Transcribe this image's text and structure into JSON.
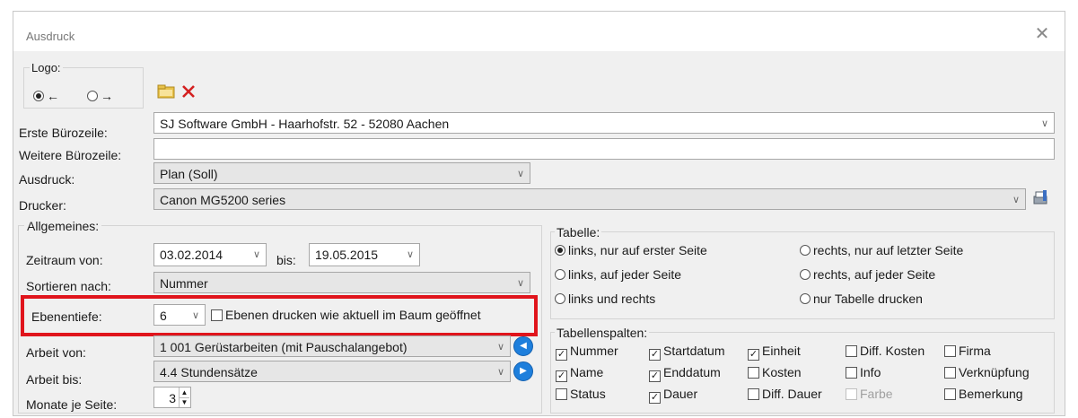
{
  "window": {
    "title": "Ausdruck"
  },
  "logo": {
    "label": "Logo:",
    "option_left": "←",
    "option_right": "→"
  },
  "fields": {
    "erste_label": "Erste Bürozeile:",
    "erste_value": "SJ Software GmbH - Haarhofstr. 52 - 52080 Aachen",
    "weitere_label": "Weitere Bürozeile:",
    "weitere_value": "",
    "ausdruck_label": "Ausdruck:",
    "ausdruck_value": "Plan (Soll)",
    "drucker_label": "Drucker:",
    "drucker_value": "Canon MG5200 series"
  },
  "allgemeines": {
    "title": "Allgemeines:",
    "zeitraum_label": "Zeitraum von:",
    "zeitraum_von": "03.02.2014",
    "bis_label": "bis:",
    "zeitraum_bis": "19.05.2015",
    "sortieren_label": "Sortieren nach:",
    "sortieren_value": "Nummer",
    "ebenentiefe_label": "Ebenentiefe:",
    "ebenentiefe_value": "6",
    "ebenen_checkbox_label": "Ebenen drucken wie aktuell im Baum geöffnet",
    "arbeit_von_label": "Arbeit von:",
    "arbeit_von_value": "1 001 Gerüstarbeiten (mit Pauschalangebot)",
    "arbeit_bis_label": "Arbeit bis:",
    "arbeit_bis_value": "4.4 Stundensätze",
    "monate_label": "Monate je Seite:",
    "monate_value": "3"
  },
  "tabelle": {
    "title": "Tabelle:",
    "options": [
      {
        "label": "links, nur auf erster Seite",
        "selected": true
      },
      {
        "label": "rechts, nur auf letzter Seite",
        "selected": false
      },
      {
        "label": "links, auf jeder Seite",
        "selected": false
      },
      {
        "label": "rechts, auf jeder Seite",
        "selected": false
      },
      {
        "label": "links und rechts",
        "selected": false
      },
      {
        "label": "nur Tabelle drucken",
        "selected": false
      }
    ]
  },
  "spalten": {
    "title": "Tabellenspalten:",
    "items": [
      {
        "label": "Nummer",
        "checked": true
      },
      {
        "label": "Startdatum",
        "checked": true
      },
      {
        "label": "Einheit",
        "checked": true
      },
      {
        "label": "Diff. Kosten",
        "checked": false
      },
      {
        "label": "Firma",
        "checked": false
      },
      {
        "label": "Name",
        "checked": true
      },
      {
        "label": "Enddatum",
        "checked": true
      },
      {
        "label": "Kosten",
        "checked": false
      },
      {
        "label": "Info",
        "checked": false
      },
      {
        "label": "Verknüpfung",
        "checked": false
      },
      {
        "label": "Status",
        "checked": false
      },
      {
        "label": "Dauer",
        "checked": true
      },
      {
        "label": "Diff. Dauer",
        "checked": false
      },
      {
        "label": "Farbe",
        "checked": false,
        "disabled": true
      },
      {
        "label": "Bemerkung",
        "checked": false
      }
    ]
  },
  "colors": {
    "highlight": "#e0141c",
    "nav_button": "#1e7fdc"
  },
  "icons": [
    "close-icon",
    "folder-open-icon",
    "delete-x-icon",
    "printer-settings-icon",
    "nav-left-icon",
    "nav-right-icon",
    "chevron-down-icon",
    "spin-up-icon",
    "spin-down-icon"
  ]
}
